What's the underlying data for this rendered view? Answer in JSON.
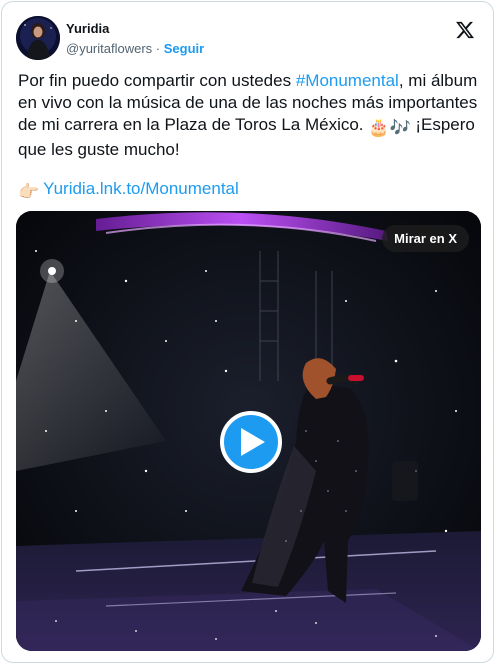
{
  "author": {
    "name": "Yuridia",
    "handle": "@yuritaflowers",
    "separator": "·",
    "follow_label": "Seguir"
  },
  "tweet": {
    "line1_pre": "Por fin puedo compartir con ustedes ",
    "hashtag": "#Monumental",
    "line1_post": ", mi álbum en vivo con la música de una de las noches más importantes de mi carrera en la Plaza de Toros La México.",
    "emoji_cake": "🎂",
    "emoji_notes": "🎶",
    "line2": " ¡Espero que les guste mucho!",
    "pointer_emoji": "👉🏻",
    "link": "Yuridia.lnk.to/Monumental"
  },
  "media": {
    "watch_label": "Mirar en X"
  },
  "icons": {
    "brand": "x-logo-icon",
    "play": "play-icon",
    "avatar": "avatar-image"
  },
  "colors": {
    "accent": "#1d9bf0",
    "text": "#0f1419",
    "muted": "#536471"
  }
}
